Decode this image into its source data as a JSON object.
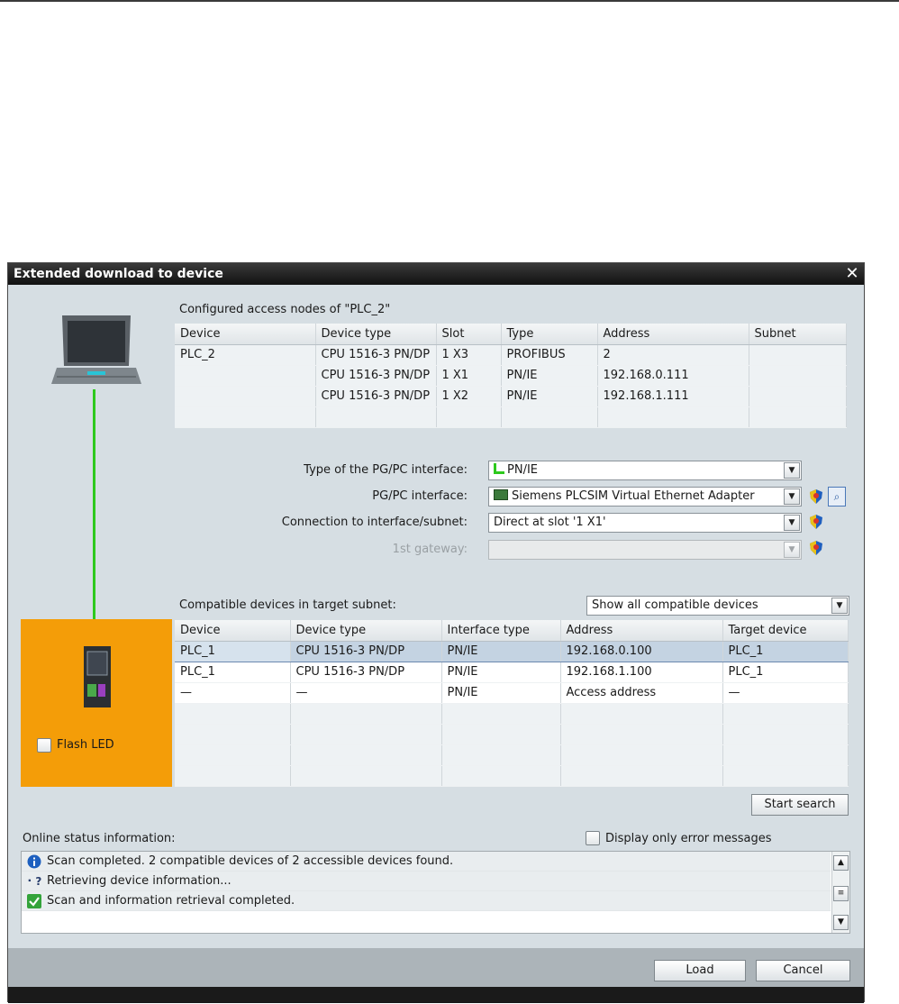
{
  "dialog": {
    "title": "Extended download to device",
    "configured_title": "Configured access nodes of \"PLC_2\"",
    "configured_table": {
      "headers": [
        "Device",
        "Device type",
        "Slot",
        "Type",
        "Address",
        "Subnet"
      ],
      "rows": [
        [
          "PLC_2",
          "CPU 1516-3 PN/DP",
          "1 X3",
          "PROFIBUS",
          "2",
          ""
        ],
        [
          "",
          "CPU 1516-3 PN/DP",
          "1 X1",
          "PN/IE",
          "192.168.0.111",
          ""
        ],
        [
          "",
          "CPU 1516-3 PN/DP",
          "1 X2",
          "PN/IE",
          "192.168.1.111",
          ""
        ]
      ]
    },
    "form": {
      "type_label": "Type of the PG/PC interface:",
      "type_value": "PN/IE",
      "interface_label": "PG/PC interface:",
      "interface_value": "Siemens PLCSIM Virtual Ethernet Adapter",
      "connection_label": "Connection to interface/subnet:",
      "connection_value": "Direct at slot '1 X1'",
      "gateway_label": "1st gateway:",
      "gateway_value": ""
    },
    "compatible_title": "Compatible devices in target subnet:",
    "filter_value": "Show all compatible devices",
    "compatible_table": {
      "headers": [
        "Device",
        "Device type",
        "Interface type",
        "Address",
        "Target device"
      ],
      "rows": [
        [
          "PLC_1",
          "CPU 1516-3 PN/DP",
          "PN/IE",
          "192.168.0.100",
          "PLC_1"
        ],
        [
          "PLC_1",
          "CPU 1516-3 PN/DP",
          "PN/IE",
          "192.168.1.100",
          "PLC_1"
        ],
        [
          "—",
          "—",
          "PN/IE",
          "Access address",
          "—"
        ]
      ]
    },
    "flash_led_label": "Flash LED",
    "start_search_label": "Start search",
    "online_status_label": "Online status information:",
    "error_only_label": "Display only error messages",
    "log": [
      {
        "icon": "info-icon",
        "text": "Scan completed. 2 compatible devices of 2 accessible devices found."
      },
      {
        "icon": "retrieving-icon",
        "text": "Retrieving device information..."
      },
      {
        "icon": "check-icon",
        "text": "Scan and information retrieval completed."
      }
    ],
    "load_label": "Load",
    "cancel_label": "Cancel"
  },
  "colors": {
    "accent_orange": "#f49d08",
    "connection_green": "#2ec91d",
    "selection_blue": "#c4d3e2"
  }
}
